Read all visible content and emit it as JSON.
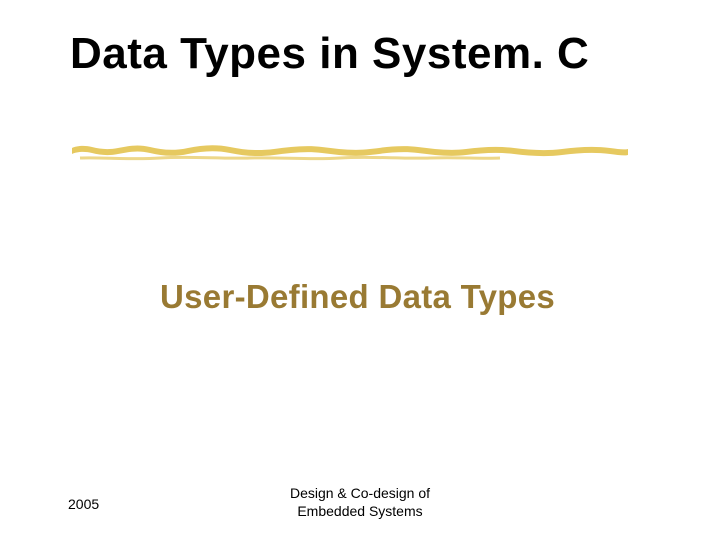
{
  "title": "Data Types in System. C",
  "subtitle": "User-Defined Data Types",
  "footer": {
    "year": "2005",
    "center_line1": "Design & Co-design of",
    "center_line2": "Embedded Systems"
  },
  "colors": {
    "brush": "#e5c657",
    "subtitle": "#997a33"
  }
}
